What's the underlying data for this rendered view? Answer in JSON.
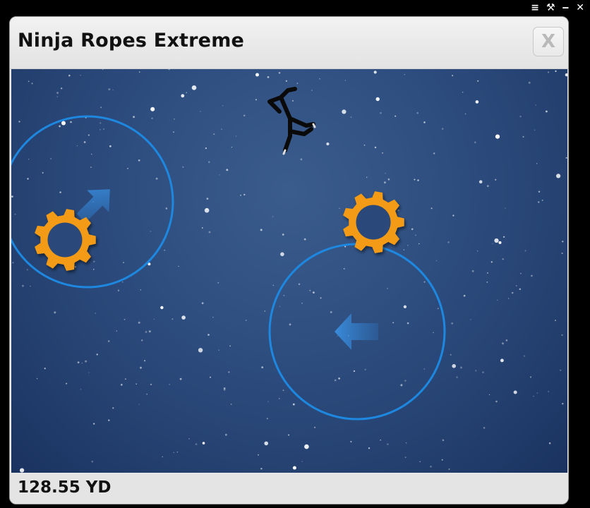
{
  "os_bar": {
    "menu_icon_glyph": "≡",
    "tools_icon_glyph": "⚒",
    "minimize_icon_glyph": "‒",
    "close_icon_glyph": "✕"
  },
  "window": {
    "title": "Ninja Ropes Extreme",
    "close_label": "X"
  },
  "status": {
    "distance": "128.55 YD"
  },
  "game": {
    "background_color": "#2a4878",
    "ring_color": "#1e88e0",
    "gear_color": "#f39a12",
    "arrow_color": "#2f7fd0",
    "ninja_color": "#0a0a0a",
    "objects": [
      {
        "type": "anchor-ring",
        "arrow": "up-right",
        "has_gear": true
      },
      {
        "type": "anchor-ring",
        "arrow": "left",
        "has_gear": false
      },
      {
        "type": "gear",
        "free": true
      }
    ]
  }
}
